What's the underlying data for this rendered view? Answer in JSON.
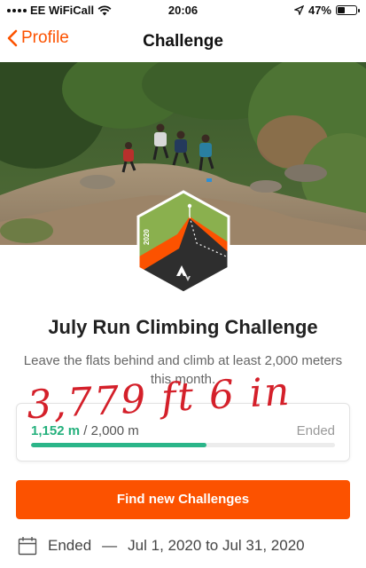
{
  "status_bar": {
    "carrier": "EE WiFiCall",
    "time": "20:06",
    "battery": "47%",
    "battery_level": 0.47
  },
  "nav": {
    "back_label": "Profile",
    "title": "Challenge"
  },
  "challenge": {
    "title": "July Run Climbing Challenge",
    "description": "Leave the flats behind and climb at least 2,000 meters this month.",
    "badge_year": "2020",
    "handwritten_note": "3,779 ft 6 in"
  },
  "progress": {
    "current": "1,152 m",
    "separator": " / ",
    "goal": "2,000 m",
    "status": "Ended",
    "fraction": 0.576
  },
  "cta_label": "Find new Challenges",
  "dates": {
    "status": "Ended",
    "dash": "—",
    "range": "Jul 1, 2020 to Jul 31, 2020"
  },
  "colors": {
    "brand_orange": "#fc5200",
    "progress_green": "#2bb589",
    "badge_green": "#8ab04e",
    "badge_dark": "#2e2e2e"
  },
  "icons": [
    "wifi-icon",
    "location-arrow-icon",
    "battery-icon",
    "chevron-left-icon",
    "calendar-icon",
    "strava-logo-icon"
  ]
}
